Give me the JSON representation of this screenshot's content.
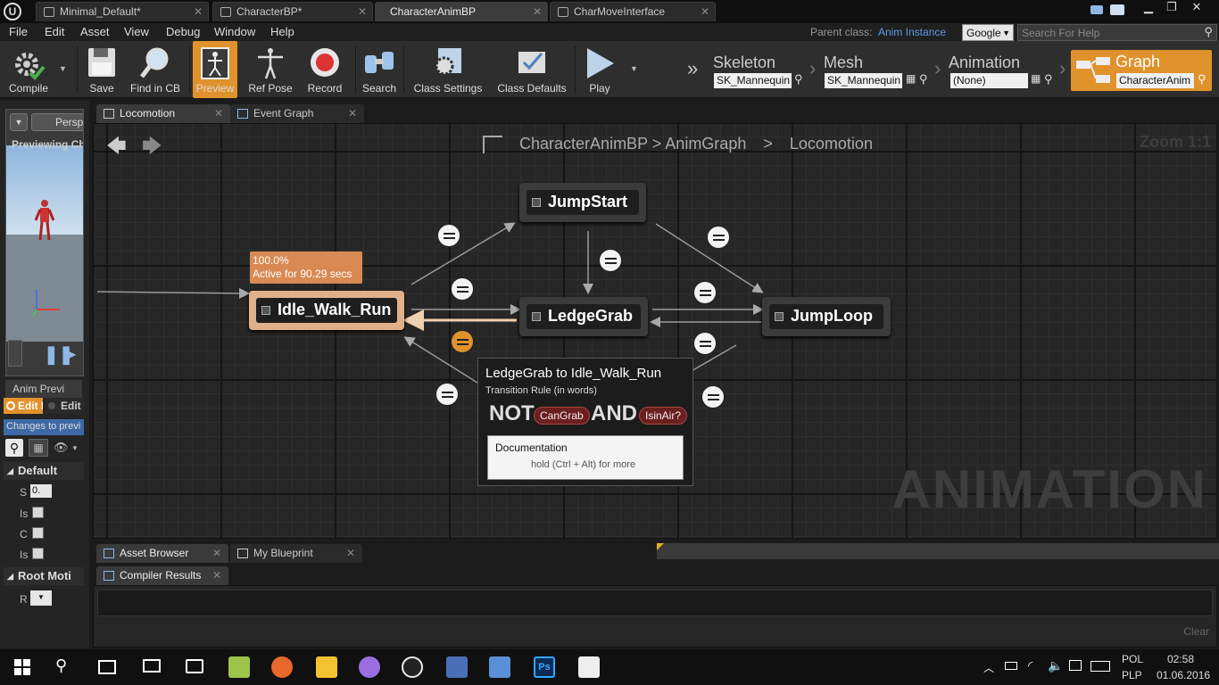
{
  "window": {
    "tabs": [
      {
        "label": "Minimal_Default*"
      },
      {
        "label": "CharacterBP*"
      },
      {
        "label": "CharacterAnimBP"
      },
      {
        "label": "CharMoveInterface"
      }
    ],
    "controls": {
      "minimize": "▁",
      "restore": "❐",
      "close": "✕"
    }
  },
  "menu": {
    "items": [
      "File",
      "Edit",
      "Asset",
      "View",
      "Debug",
      "Window",
      "Help"
    ],
    "parent_class_label": "Parent class:",
    "parent_class_value": "Anim Instance",
    "search_engine": "Google",
    "search_placeholder": "Search For Help"
  },
  "toolbar": {
    "buttons": [
      {
        "label": "Compile",
        "icon": "gear-check-icon"
      },
      {
        "label": "Save",
        "icon": "floppy-icon"
      },
      {
        "label": "Find in CB",
        "icon": "magnifier-icon"
      },
      {
        "label": "Preview",
        "icon": "character-preview-icon"
      },
      {
        "label": "Ref Pose",
        "icon": "ref-pose-icon"
      },
      {
        "label": "Record",
        "icon": "record-icon"
      },
      {
        "label": "Search",
        "icon": "binoculars-icon"
      },
      {
        "label": "Class Settings",
        "icon": "class-settings-icon"
      },
      {
        "label": "Class Defaults",
        "icon": "class-defaults-icon"
      },
      {
        "label": "Play",
        "icon": "play-icon"
      }
    ],
    "modes": {
      "skeleton": {
        "label": "Skeleton",
        "value": "SK_Mannequin"
      },
      "mesh": {
        "label": "Mesh",
        "value": "SK_Mannequin"
      },
      "animation": {
        "label": "Animation",
        "value": "(None)"
      },
      "graph": {
        "label": "Graph",
        "value": "CharacterAnim"
      }
    },
    "accent_color": "#e0922c"
  },
  "left_panel": {
    "viewport_mode": "Persp",
    "previewing_text": "Previewing Ch",
    "anim_preview_tab": "Anim Previ",
    "edit_tab1": "Edit I",
    "edit_tab2": "Edit I",
    "changes_text": "Changes to previ",
    "default_section": "Default",
    "rows": [
      "S",
      "Is",
      "C",
      "Is"
    ],
    "s_value": "0.",
    "root_motion_section": "Root Moti",
    "root_row": "R"
  },
  "graph": {
    "tabs": [
      {
        "label": "Locomotion"
      },
      {
        "label": "Event Graph"
      }
    ],
    "breadcrumb": {
      "first": "CharacterAnimBP",
      "second": "AnimGraph",
      "third": "Locomotion",
      "sep": ">"
    },
    "zoom": "Zoom 1:1",
    "watermark": "ANIMATION",
    "states": {
      "idle": "Idle_Walk_Run",
      "jumpstart": "JumpStart",
      "ledgegrab": "LedgeGrab",
      "jumploop": "JumpLoop"
    },
    "active_badge": {
      "percent": "100.0%",
      "time": "Active for 90.29 secs"
    },
    "tooltip": {
      "title": "LedgeGrab to Idle_Walk_Run",
      "subtitle": "Transition Rule (in words)",
      "not": "NOT",
      "var1": "CanGrab",
      "and": "AND",
      "var2": "IsinAir?",
      "doc_title": "Documentation",
      "doc_hint": "hold (Ctrl + Alt) for more"
    }
  },
  "bottom": {
    "tabs1": [
      {
        "label": "Asset Browser"
      },
      {
        "label": "My Blueprint"
      }
    ],
    "tabs2": [
      {
        "label": "Compiler Results"
      }
    ],
    "clear": "Clear"
  },
  "taskbar": {
    "lang1": "POL",
    "lang2": "PLP",
    "time": "02:58",
    "date": "01.06.2016"
  }
}
